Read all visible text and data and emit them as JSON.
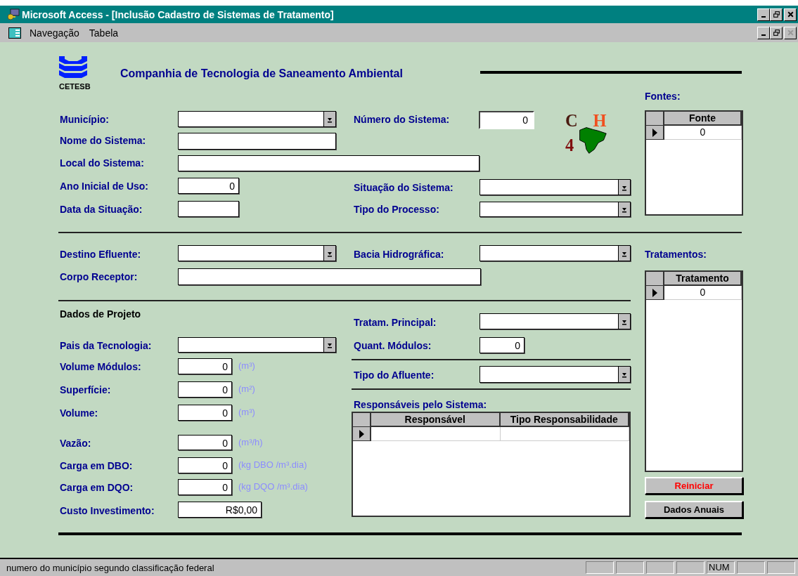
{
  "window": {
    "title": "Microsoft Access - [Inclusão Cadastro de Sistemas de Tratamento]"
  },
  "menu": [
    {
      "label": "Navegação"
    },
    {
      "label": "Tabela"
    }
  ],
  "header": {
    "logo_caption": "CETESB",
    "company": "Companhia de Tecnologia de Saneamento Ambiental",
    "badge_letters": [
      "C",
      "H",
      "4"
    ]
  },
  "fields": [
    {
      "label": "Município:",
      "kind": "combo"
    },
    {
      "label": "Número do Sistema:",
      "kind": "text",
      "value": "0"
    },
    {
      "label": "Nome do Sistema:",
      "kind": "text"
    },
    {
      "label": "Local do Sistema:",
      "kind": "text"
    },
    {
      "label": "Ano Inicial de Uso:",
      "kind": "text",
      "value": "0"
    },
    {
      "label": "Situação do Sistema:",
      "kind": "combo"
    },
    {
      "label": "Data da Situação:",
      "kind": "text"
    },
    {
      "label": "Tipo do Processo:",
      "kind": "combo"
    },
    {
      "label": "Destino  Efluente:",
      "kind": "combo"
    },
    {
      "label": "Bacia Hidrográfica:",
      "kind": "combo"
    },
    {
      "label": "Corpo Receptor:",
      "kind": "text"
    },
    {
      "label": "Tratam. Principal:",
      "kind": "combo"
    },
    {
      "label": "Pais da Tecnologia:",
      "kind": "combo"
    },
    {
      "label": "Quant. Módulos:",
      "kind": "text",
      "value": "0"
    },
    {
      "label": "Volume Módulos:",
      "kind": "text",
      "value": "0",
      "unit": "(m³)"
    },
    {
      "label": "Tipo do Afluente:",
      "kind": "combo"
    },
    {
      "label": "Superfície:",
      "kind": "text",
      "value": "0",
      "unit": "(m²)"
    },
    {
      "label": "Volume:",
      "kind": "text",
      "value": "0",
      "unit": "(m³)"
    },
    {
      "label": "Vazão:",
      "kind": "text",
      "value": "0",
      "unit": "(m³/h)"
    },
    {
      "label": "Carga em DBO:",
      "kind": "text",
      "value": "0",
      "unit": "(kg DBO /m³.dia)"
    },
    {
      "label": "Carga em DQO:",
      "kind": "text",
      "value": "0",
      "unit": "(kg DQO /m³.dia)"
    },
    {
      "label": "Custo Investimento:",
      "kind": "text",
      "value": "R$0,00"
    }
  ],
  "section_title": "Dados de Projeto",
  "subforms": [
    {
      "title": "Fontes:",
      "columns": [
        "Fonte"
      ],
      "rows": [
        {
          "current": true,
          "cells": [
            "0"
          ]
        }
      ]
    },
    {
      "title": "Tratamentos:",
      "columns": [
        "Tratamento"
      ],
      "rows": [
        {
          "current": true,
          "cells": [
            "0"
          ]
        }
      ]
    },
    {
      "title": "Responsáveis pelo Sistema:",
      "columns": [
        "Responsável",
        "Tipo Responsabilidade"
      ],
      "rows": [
        {
          "current": true
        }
      ]
    }
  ],
  "buttons": [
    {
      "label": "Reiniciar",
      "kind": "danger"
    },
    {
      "label": "Dados Anuais",
      "kind": "normal"
    }
  ],
  "status_bar": {
    "text": "numero do município segundo classificação federal",
    "num_indicator": "NUM"
  }
}
